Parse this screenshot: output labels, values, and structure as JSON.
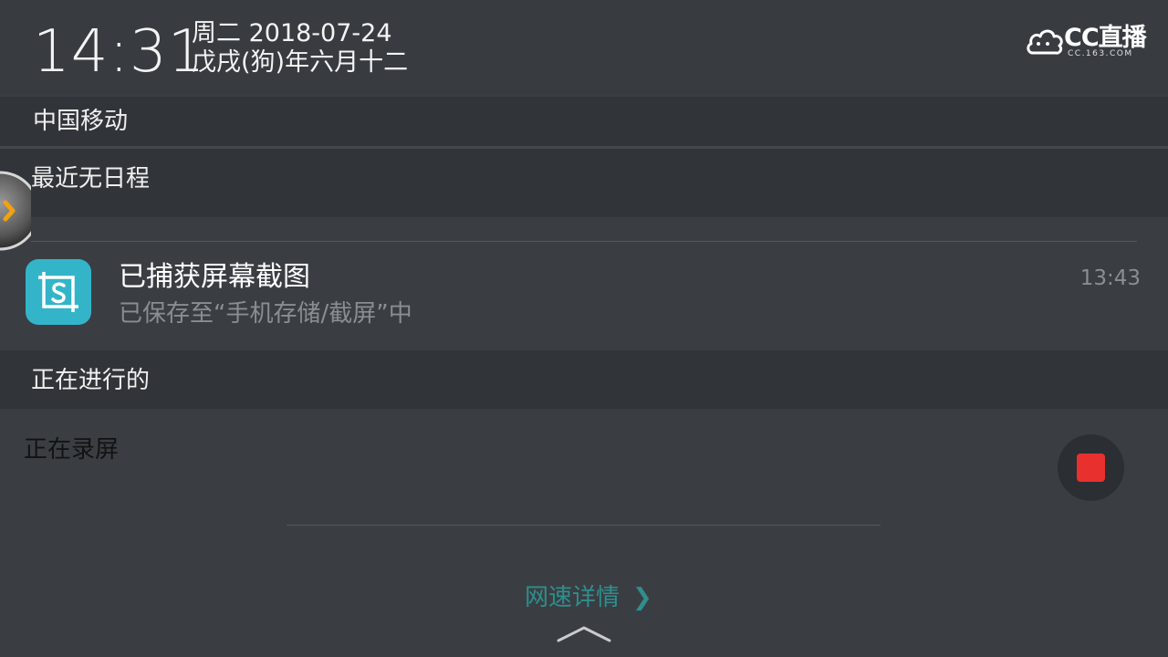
{
  "header": {
    "clock": "14:31",
    "date_line1": "周二 2018-07-24",
    "date_line2": "戊戌(狗)年六月十二",
    "logo_text": "CC直播",
    "logo_sub": "CC.163.COM"
  },
  "carrier": "中国移动",
  "schedule": "最近无日程",
  "notification": {
    "icon": "screenshot-app-icon",
    "title": "已捕获屏幕截图",
    "body": "已保存至“手机存储/截屏”中",
    "time": "13:43"
  },
  "ongoing": {
    "section_title": "正在进行的",
    "recording_label": "正在录屏",
    "stop_icon": "stop-icon"
  },
  "footer": {
    "network_details": "网速详情",
    "arrow": "❯",
    "handle_icon": "chevron-up-icon"
  },
  "colors": {
    "accent_teal": "#2e8f8d",
    "app_icon_bg": "#34b4c8",
    "stop_red": "#e8302e"
  }
}
